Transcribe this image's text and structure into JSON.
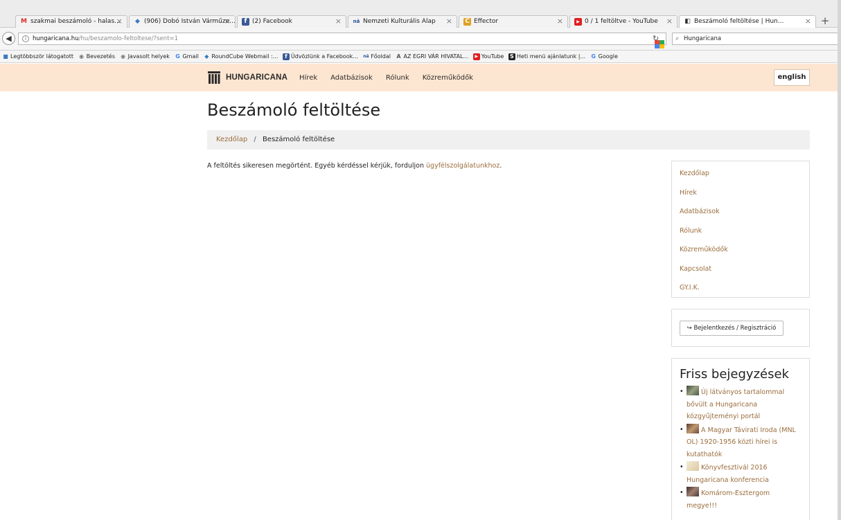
{
  "tabs": [
    {
      "icon": "gmail-icon",
      "icon_char": "M",
      "icon_color": "#d93025",
      "title": "szakmai beszámoló - halas..."
    },
    {
      "icon": "globe-icon",
      "icon_char": "◆",
      "icon_color": "#3a7bbf",
      "title": "(906) Dobó István Várműze..."
    },
    {
      "icon": "facebook-icon",
      "icon_char": "f",
      "icon_color": "#3b5998",
      "title": "(2) Facebook"
    },
    {
      "icon": "nka-icon",
      "icon_char": "nä",
      "icon_color": "#1f4e9a",
      "title": "Nemzeti Kulturális Alap"
    },
    {
      "icon": "effector-icon",
      "icon_char": "C",
      "icon_color": "#e0a020",
      "title": "Effector"
    },
    {
      "icon": "youtube-icon",
      "icon_char": "▶",
      "icon_color": "#e02020",
      "title": "0 / 1 feltöltve - YouTube"
    },
    {
      "icon": "hungaricana-icon",
      "icon_char": "◧",
      "icon_color": "#2b2b2b",
      "title": "Beszámoló feltöltése | Hun..."
    }
  ],
  "tab_close": "×",
  "new_tab": "+",
  "address": {
    "host": "hungaricana.hu",
    "path": "/hu/beszamolo-feltoltese/?sent=1"
  },
  "search_box": {
    "value": "Hungaricana"
  },
  "bookmarks": [
    {
      "icon": "bookmark-folder-icon",
      "icon_char": "■",
      "icon_color": "#3a7bbf",
      "label": "Legtöbbször látogatott"
    },
    {
      "icon": "globe-icon",
      "icon_char": "◉",
      "icon_color": "#777777",
      "label": "Bevezetés"
    },
    {
      "icon": "globe-icon",
      "icon_char": "◉",
      "icon_color": "#777777",
      "label": "Javasolt helyek"
    },
    {
      "icon": "google-icon",
      "icon_char": "G",
      "icon_color": "#4285f4",
      "label": "Gmail"
    },
    {
      "icon": "roundcube-icon",
      "icon_char": "◆",
      "icon_color": "#3a7bbf",
      "label": "RoundCube Webmail :..."
    },
    {
      "icon": "facebook-icon",
      "icon_char": "f",
      "icon_color": "#3b5998",
      "label": "Üdvözlünk a Facebook..."
    },
    {
      "icon": "nka-icon",
      "icon_char": "nä",
      "icon_color": "#1f4e9a",
      "label": "Főoldal"
    },
    {
      "icon": "egri-var-icon",
      "icon_char": "A",
      "icon_color": "#555555",
      "label": "AZ EGRI VÁR HIVATAL..."
    },
    {
      "icon": "youtube-icon",
      "icon_char": "▶",
      "icon_color": "#e02020",
      "label": "YouTube"
    },
    {
      "icon": "menu-s-icon",
      "icon_char": "S",
      "icon_color": "#222222",
      "label": "Heti menü ajánlatunk |..."
    },
    {
      "icon": "google-icon",
      "icon_char": "G",
      "icon_color": "#4285f4",
      "label": "Google"
    }
  ],
  "site": {
    "logo_text": "HUNGARICANA",
    "nav": [
      "Hírek",
      "Adatbázisok",
      "Rólunk",
      "Közreműködők"
    ],
    "lang_button": "english"
  },
  "page": {
    "title": "Beszámoló feltöltése",
    "breadcrumb": {
      "home": "Kezdőlap",
      "separator": "/",
      "current": "Beszámoló feltöltése"
    },
    "message_before": "A feltöltés sikeresen megörtént. Egyéb kérdéssel kérjük, forduljon ",
    "message_link": "ügyfélszolgálatunkhoz",
    "message_after": "."
  },
  "sidebar": {
    "menu": [
      "Kezdőlap",
      "Hírek",
      "Adatbázisok",
      "Rólunk",
      "Közreműködők",
      "Kapcsolat",
      "GY.I.K."
    ],
    "login_icon": "↪",
    "login_label": "Bejelentkezés / Regisztráció",
    "recent_title": "Friss bejegyzések",
    "recent_bullet": "•",
    "recent": [
      {
        "text": "Új látványos tartalommal bővült a Hungaricana közgyűjteményi portál",
        "thumb_color": "#6a7a5a"
      },
      {
        "text": "A Magyar Távirati Iroda (MNL OL) 1920-1956 közti hírei is kutathatók",
        "thumb_color": "#8a6a4a"
      },
      {
        "text": "Könyvfesztivál 2016 Hungaricana konferencia",
        "thumb_color": "#e8dcc0"
      },
      {
        "text": "Komárom-Esztergom megye!!!",
        "thumb_color": "#7a5a4a"
      }
    ]
  },
  "colors": {
    "accent_link": "#9a6d3c",
    "nav_background": "#fde6d1"
  }
}
